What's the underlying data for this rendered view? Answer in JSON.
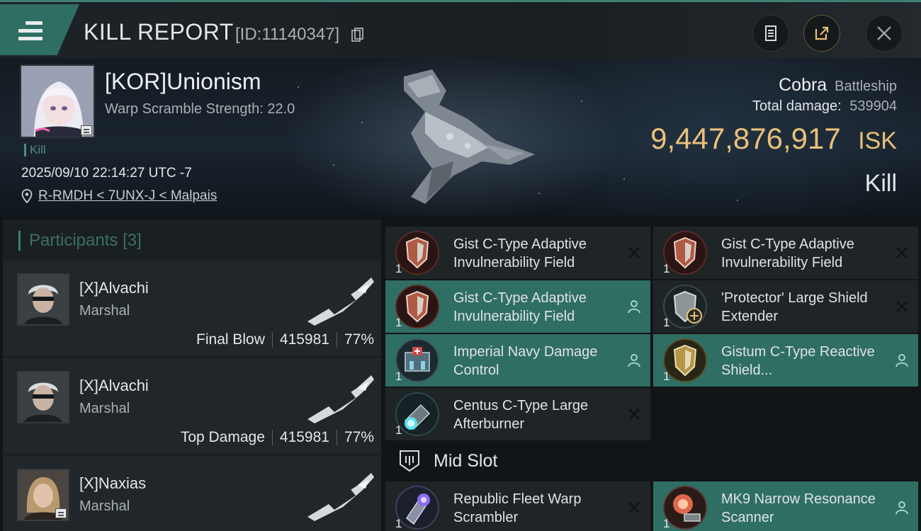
{
  "header": {
    "title": "KILL REPORT",
    "report_id": "[ID:11140347]"
  },
  "victim": {
    "name": "[KOR]Unionism",
    "warp_scramble": "Warp Scramble Strength: 22.0",
    "tag": "Kill",
    "timestamp": "2025/09/10 22:14:27 UTC -7",
    "location": "R-RMDH < 7UNX-J < Malpais"
  },
  "ship": {
    "name": "Cobra",
    "class": "Battleship",
    "damage_label": "Total damage:",
    "damage_value": "539904",
    "isk_value": "9,447,876,917",
    "isk_unit": "ISK",
    "result": "Kill"
  },
  "participants": {
    "label": "Participants",
    "count": "[3]",
    "items": [
      {
        "name": "[X]Alvachi",
        "rank": "Marshal",
        "role": "Final Blow",
        "damage": "415981",
        "percent": "77%"
      },
      {
        "name": "[X]Alvachi",
        "rank": "Marshal",
        "role": "Top Damage",
        "damage": "415981",
        "percent": "77%"
      },
      {
        "name": "[X]Naxias",
        "rank": "Marshal",
        "role": "",
        "damage": "",
        "percent": ""
      }
    ]
  },
  "modules": {
    "low": [
      {
        "name": "Gist C-Type Adaptive Invulnerability Field",
        "qty": "1",
        "status": "destroyed",
        "icon": "shield-hardener-icon"
      },
      {
        "name": "Gist C-Type Adaptive Invulnerability Field",
        "qty": "1",
        "status": "destroyed",
        "icon": "shield-hardener-icon"
      },
      {
        "name": "Gist C-Type Adaptive Invulnerability Field",
        "qty": "1",
        "status": "dropped",
        "icon": "shield-hardener-icon"
      },
      {
        "name": "'Protector' Large Shield Extender",
        "qty": "1",
        "status": "destroyed",
        "icon": "shield-extender-icon"
      },
      {
        "name": "Imperial Navy Damage Control",
        "qty": "1",
        "status": "dropped",
        "icon": "damage-control-icon"
      },
      {
        "name": "Gistum C-Type Reactive Shield...",
        "qty": "1",
        "status": "dropped",
        "icon": "reactive-shield-icon"
      },
      {
        "name": "Centus C-Type Large Afterburner",
        "qty": "1",
        "status": "destroyed",
        "icon": "afterburner-icon"
      }
    ],
    "mid_slot_label": "Mid Slot",
    "mid": [
      {
        "name": "Republic Fleet Warp Scrambler",
        "qty": "1",
        "status": "destroyed",
        "icon": "warp-scrambler-icon"
      },
      {
        "name": "MK9 Narrow Resonance Scanner",
        "qty": "1",
        "status": "dropped",
        "icon": "scanner-icon"
      }
    ]
  },
  "colors": {
    "accent": "#2f6e63",
    "isk": "#e8c17a"
  }
}
